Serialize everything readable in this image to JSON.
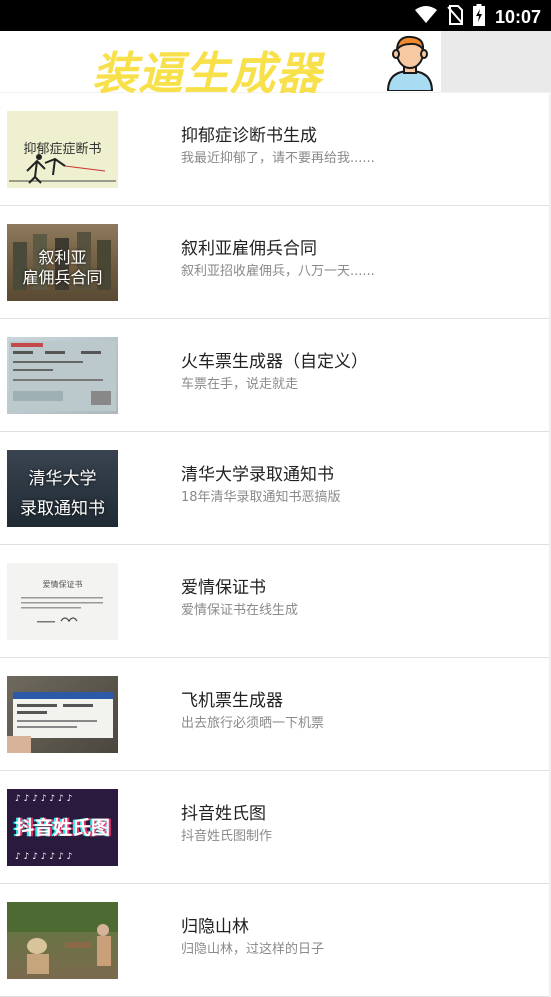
{
  "status_bar": {
    "time": "10:07",
    "icons": [
      "wifi-icon",
      "no-sim-icon",
      "battery-charging-icon"
    ]
  },
  "header": {
    "title": "装逼生成器",
    "title_color": "#f7e04a",
    "avatar_icon": "user-avatar-icon"
  },
  "items": [
    {
      "title": "抑郁症诊断书生成",
      "subtitle": "我最近抑郁了，请不要再给我......",
      "thumb_text": "抑郁症症断书",
      "thumb_icon": "depression-thumb"
    },
    {
      "title": "叙利亚雇佣兵合同",
      "subtitle": "叙利亚招收雇佣兵，八万一天......",
      "thumb_text_1": "叙利亚",
      "thumb_text_2": "雇佣兵合同",
      "thumb_icon": "soldiers-thumb"
    },
    {
      "title": "火车票生成器（自定义）",
      "subtitle": "车票在手，说走就走",
      "thumb_icon": "train-ticket-thumb"
    },
    {
      "title": "清华大学录取通知书",
      "subtitle": "18年清华录取通知书恶搞版",
      "thumb_text_1": "清华大学",
      "thumb_text_2": "录取通知书",
      "thumb_icon": "admission-letter-thumb"
    },
    {
      "title": "爱情保证书",
      "subtitle": "爱情保证书在线生成",
      "thumb_text": "爱情保证书",
      "thumb_icon": "love-letter-thumb"
    },
    {
      "title": "飞机票生成器",
      "subtitle": "出去旅行必须晒一下机票",
      "thumb_icon": "boarding-pass-thumb"
    },
    {
      "title": "抖音姓氏图",
      "subtitle": "抖音姓氏图制作",
      "thumb_text": "抖音姓氏图",
      "thumb_icon": "douyin-thumb"
    },
    {
      "title": "归隐山林",
      "subtitle": "归隐山林，过这样的日子",
      "thumb_icon": "countryside-thumb"
    }
  ]
}
